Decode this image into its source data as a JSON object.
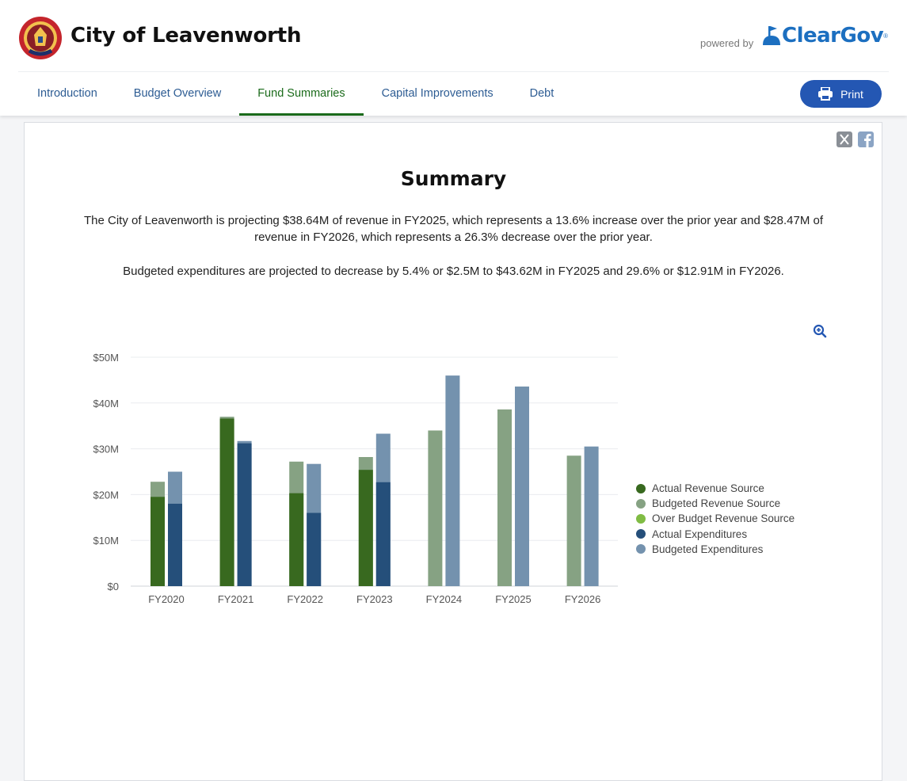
{
  "header": {
    "city_name": "City of Leavenworth",
    "powered_by": "powered by",
    "brand": "ClearGov",
    "brand_mark": "®"
  },
  "nav": {
    "tabs": [
      {
        "label": "Introduction"
      },
      {
        "label": "Budget Overview"
      },
      {
        "label": "Fund Summaries",
        "active": true
      },
      {
        "label": "Capital Improvements"
      },
      {
        "label": "Debt"
      }
    ],
    "print_label": "Print"
  },
  "main": {
    "title": "Summary",
    "paragraph1": "The City of Leavenworth is projecting $38.64M of revenue in FY2025, which represents a 13.6% increase over the prior year and $28.47M of revenue in FY2026, which represents a 26.3% decrease over the prior year.",
    "paragraph2": "Budgeted expenditures are projected to decrease by 5.4% or $2.5M to $43.62M in FY2025 and 29.6% or $12.91M in FY2026."
  },
  "colors": {
    "brand_blue": "#1c6fc0",
    "nav_active": "#1b6b1b",
    "print_button": "#2457b3"
  },
  "icons": {
    "print": "printer-icon",
    "zoom": "zoom-in-icon",
    "share_x": "x-icon",
    "share_facebook": "facebook-icon"
  },
  "chart_data": {
    "type": "bar",
    "categories": [
      "FY2020",
      "FY2021",
      "FY2022",
      "FY2023",
      "FY2024",
      "FY2025",
      "FY2026"
    ],
    "y_ticks": [
      "$0",
      "$10M",
      "$20M",
      "$30M",
      "$40M",
      "$50M"
    ],
    "ylim": [
      0,
      50
    ],
    "grid": true,
    "legend_position": "right",
    "series": [
      {
        "name": "Actual Revenue Source",
        "color": "#38691f",
        "values": [
          19.5,
          36.6,
          20.3,
          25.4,
          null,
          null,
          null
        ]
      },
      {
        "name": "Budgeted Revenue Source",
        "color": "#86a283",
        "values": [
          22.8,
          37.0,
          27.2,
          28.2,
          34.0,
          38.6,
          28.5
        ]
      },
      {
        "name": "Over Budget Revenue Source",
        "color": "#80bc44",
        "values": [
          null,
          null,
          null,
          null,
          null,
          null,
          null
        ]
      },
      {
        "name": "Actual Expenditures",
        "color": "#254f7a",
        "values": [
          18.0,
          31.2,
          16.0,
          22.7,
          null,
          null,
          null
        ]
      },
      {
        "name": "Budgeted Expenditures",
        "color": "#7492ae",
        "values": [
          25.0,
          31.7,
          26.7,
          33.3,
          46.0,
          43.6,
          30.5
        ]
      }
    ]
  }
}
